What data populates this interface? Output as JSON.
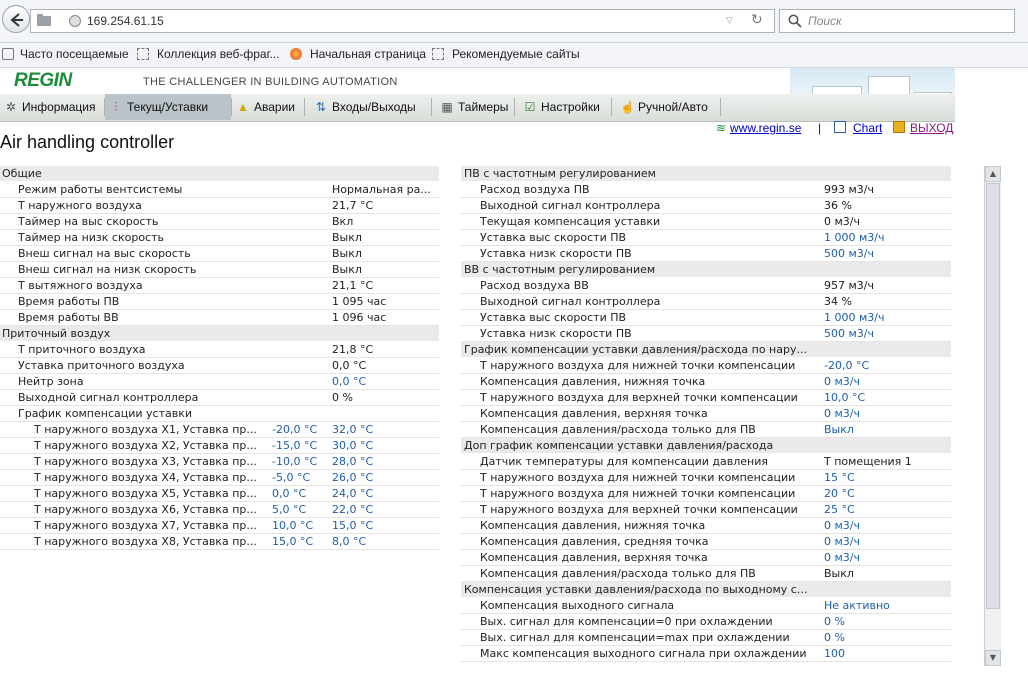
{
  "browser": {
    "url": "169.254.61.15",
    "search_placeholder": "Поиск",
    "bookmarks": [
      "Часто посещаемые",
      "Коллекция веб-фраг...",
      "Начальная страница",
      "Рекомендуемые сайты"
    ]
  },
  "header": {
    "logo": "REGIN",
    "tagline": "THE CHALLENGER IN BUILDING AUTOMATION"
  },
  "nav": [
    {
      "label": "Информация",
      "icon": "gear-icon"
    },
    {
      "label": "Текущ/Уставки",
      "icon": "thermometer-icon"
    },
    {
      "label": "Аварии",
      "icon": "bell-icon"
    },
    {
      "label": "Входы/Выходы",
      "icon": "arrows-icon"
    },
    {
      "label": "Таймеры",
      "icon": "calendar-icon"
    },
    {
      "label": "Настройки",
      "icon": "checklist-icon"
    },
    {
      "label": "Ручной/Авто",
      "icon": "hand-icon"
    }
  ],
  "links": {
    "site": "www.regin.se",
    "separator": "|",
    "chart": "Chart",
    "logout": "ВЫХОД"
  },
  "page_title": "Air handling controller",
  "left": {
    "general": {
      "title": "Общие",
      "rows": [
        {
          "label": "Режим работы вентсистемы",
          "value": "Нормальная ра..."
        },
        {
          "label": "Т наружного воздуха",
          "value": "21,7 °C"
        },
        {
          "label": "Таймер на выс скорость",
          "value": "Вкл"
        },
        {
          "label": "Таймер на низк скорость",
          "value": "Выкл"
        },
        {
          "label": "Внеш сигнал на выс скорость",
          "value": "Выкл"
        },
        {
          "label": "Внеш сигнал на низк скорость",
          "value": "Выкл"
        },
        {
          "label": "Т вытяжного воздуха",
          "value": "21,1 °C"
        },
        {
          "label": "Время работы ПВ",
          "value": "1 095 час"
        },
        {
          "label": "Время работы ВВ",
          "value": "1 096 час"
        }
      ]
    },
    "supply": {
      "title": "Приточный воздух",
      "rows": [
        {
          "label": "Т приточного воздуха",
          "value": "21,8 °C",
          "editable": false
        },
        {
          "label": "Уставка приточного воздуха",
          "value": "0,0 °C",
          "editable": false
        },
        {
          "label": "Нейтр зона",
          "value": "0,0 °C",
          "editable": true
        },
        {
          "label": "Выходной сигнал контроллера",
          "value": "0 %",
          "editable": false
        },
        {
          "label": "График компенсации уставки",
          "value": "",
          "editable": false
        }
      ],
      "curve": [
        {
          "label": "Т наружного воздуха X1, Уставка пр...",
          "x": "-20,0 °C",
          "y": "32,0 °C"
        },
        {
          "label": "Т наружного воздуха X2, Уставка пр...",
          "x": "-15,0 °C",
          "y": "30,0 °C"
        },
        {
          "label": "Т наружного воздуха X3, Уставка пр...",
          "x": "-10,0 °C",
          "y": "28,0 °C"
        },
        {
          "label": "Т наружного воздуха X4, Уставка пр...",
          "x": "-5,0 °C",
          "y": "26,0 °C"
        },
        {
          "label": "Т наружного воздуха X5, Уставка пр...",
          "x": "0,0 °C",
          "y": "24,0 °C"
        },
        {
          "label": "Т наружного воздуха X6, Уставка пр...",
          "x": "5,0 °C",
          "y": "22,0 °C"
        },
        {
          "label": "Т наружного воздуха X7, Уставка пр...",
          "x": "10,0 °C",
          "y": "15,0 °C"
        },
        {
          "label": "Т наружного воздуха X8, Уставка пр...",
          "x": "15,0 °C",
          "y": "8,0 °C"
        }
      ]
    }
  },
  "right": {
    "sections": [
      {
        "title": "ПВ с частотным регулированием",
        "rows": [
          {
            "label": "Расход воздуха ПВ",
            "value": "993 м3/ч",
            "editable": false
          },
          {
            "label": "Выходной сигнал контроллера",
            "value": "36 %",
            "editable": false
          },
          {
            "label": "Текущая компенсация уставки",
            "value": "0 м3/ч",
            "editable": false
          },
          {
            "label": "Уставка выс скорости ПВ",
            "value": "1 000 м3/ч",
            "editable": true
          },
          {
            "label": "Уставка низк скорости ПВ",
            "value": "500 м3/ч",
            "editable": true
          }
        ]
      },
      {
        "title": "ВВ с частотным регулированием",
        "rows": [
          {
            "label": "Расход воздуха ВВ",
            "value": "957 м3/ч",
            "editable": false
          },
          {
            "label": "Выходной сигнал контроллера",
            "value": "34 %",
            "editable": false
          },
          {
            "label": "Уставка выс скорости ПВ",
            "value": "1 000 м3/ч",
            "editable": true
          },
          {
            "label": "Уставка низк скорости ПВ",
            "value": "500 м3/ч",
            "editable": true
          }
        ]
      },
      {
        "title": "График компенсации уставки давления/расхода по нару...",
        "rows": [
          {
            "label": "Т наружного воздуха для нижней точки компенсации",
            "value": "-20,0 °C",
            "editable": true
          },
          {
            "label": "Компенсация давления, нижняя точка",
            "value": "0 м3/ч",
            "editable": true
          },
          {
            "label": "Т наружного воздуха для верхней точки компенсации",
            "value": "10,0 °C",
            "editable": true
          },
          {
            "label": "Компенсация давления, верхняя точка",
            "value": "0 м3/ч",
            "editable": true
          },
          {
            "label": "Компенсация давления/расхода только для ПВ",
            "value": "Выкл",
            "editable": true
          }
        ]
      },
      {
        "title": "Доп график компенсации уставки давления/расхода",
        "rows": [
          {
            "label": "Датчик температуры для компенсации давления",
            "value": "Т помещения 1",
            "editable": false
          },
          {
            "label": "Т наружного воздуха для нижней точки компенсации",
            "value": "15 °C",
            "editable": true
          },
          {
            "label": "Т наружного воздуха для нижней точки компенсации",
            "value": "20 °C",
            "editable": true
          },
          {
            "label": "Т наружного воздуха для верхней точки компенсации",
            "value": "25 °C",
            "editable": true
          },
          {
            "label": "Компенсация давления, нижняя точка",
            "value": "0 м3/ч",
            "editable": true
          },
          {
            "label": "Компенсация давления, средняя точка",
            "value": "0 м3/ч",
            "editable": true
          },
          {
            "label": "Компенсация давления, верхняя точка",
            "value": "0 м3/ч",
            "editable": true
          },
          {
            "label": "Компенсация давления/расхода только для ПВ",
            "value": "Выкл",
            "editable": false
          }
        ]
      },
      {
        "title": "Компенсация уставки давления/расхода по выходному с...",
        "rows": [
          {
            "label": "Компенсация выходного сигнала",
            "value": "Не активно",
            "editable": true
          },
          {
            "label": "Вых. сигнал для компенсации=0 при охлаждении",
            "value": "0 %",
            "editable": true
          },
          {
            "label": "Вых. сигнал для компенсации=max при охлаждении",
            "value": "0 %",
            "editable": true
          },
          {
            "label": "Макс компенсация выходного сигнала при охлаждении",
            "value": "100",
            "editable": true
          }
        ]
      }
    ]
  }
}
